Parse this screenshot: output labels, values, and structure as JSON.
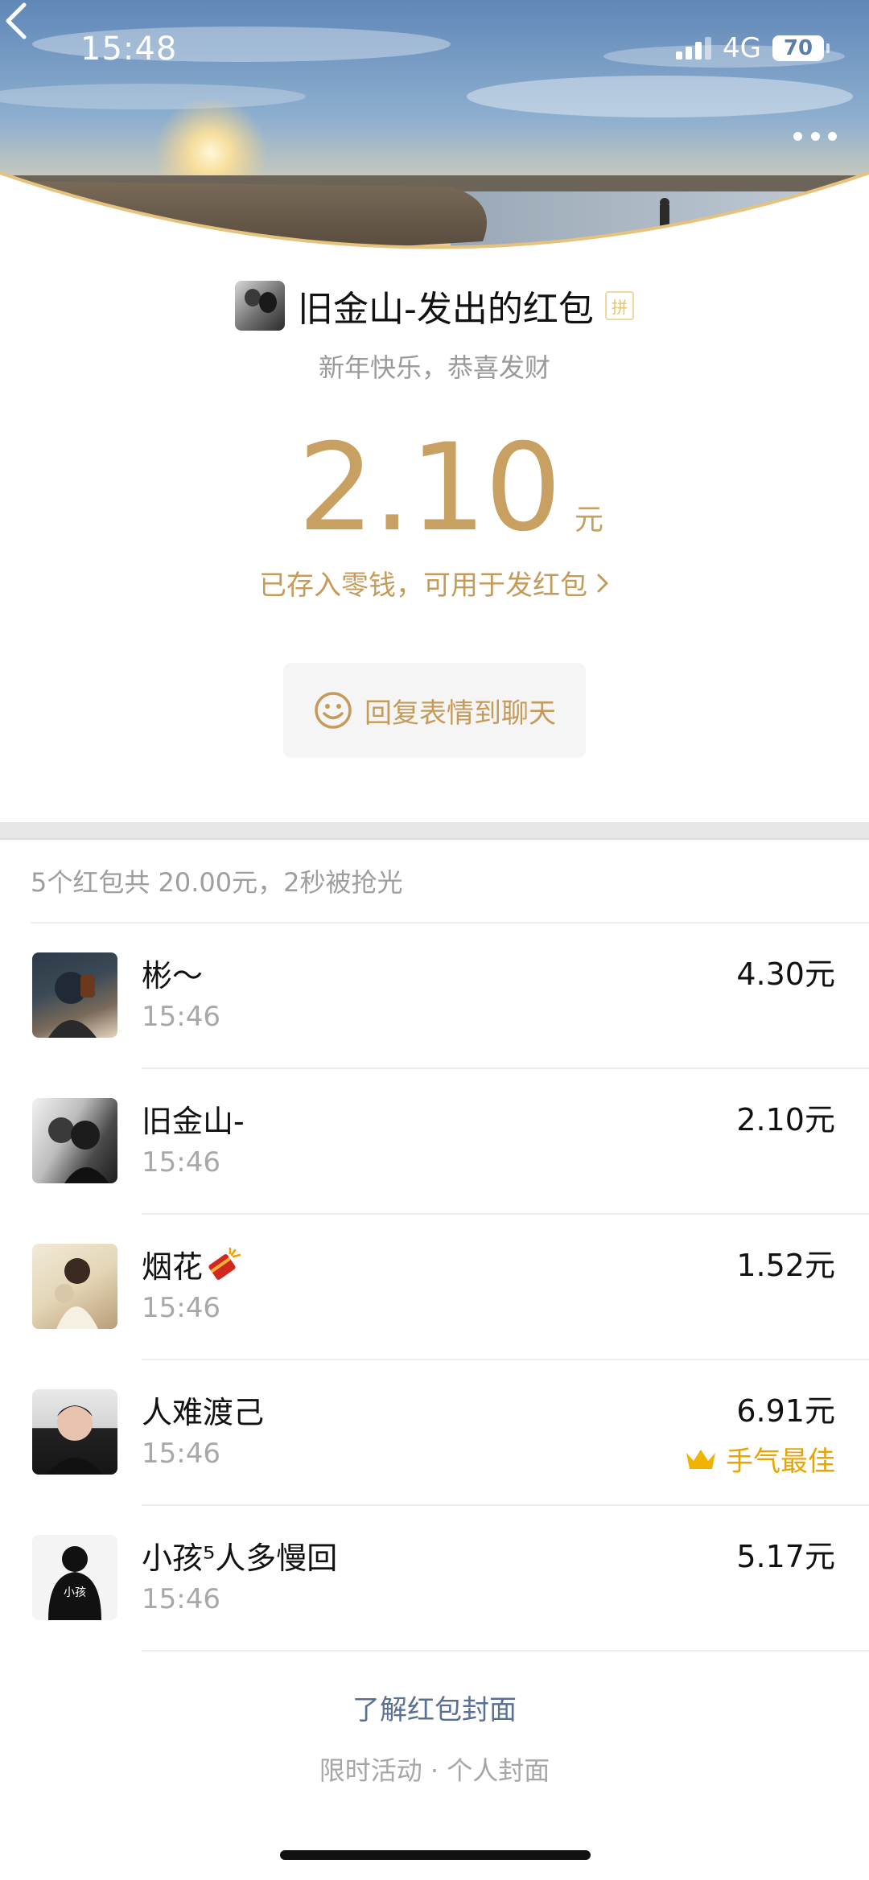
{
  "status_bar": {
    "time": "15:48",
    "network": "4G",
    "battery": "70"
  },
  "header": {
    "sender_title": "旧金山-发出的红包",
    "pin_badge": "拼",
    "greeting": "新年快乐，恭喜发财",
    "amount": "2.10",
    "amount_unit": "元",
    "deposit_link": "已存入零钱，可用于发红包",
    "reply_button": "回复表情到聊天"
  },
  "summary": "5个红包共 20.00元，2秒被抢光",
  "claims": [
    {
      "name": "彬～",
      "time": "15:46",
      "amount": "4.30元"
    },
    {
      "name": "旧金山-",
      "time": "15:46",
      "amount": "2.10元"
    },
    {
      "name": "烟花",
      "time": "15:46",
      "amount": "1.52元"
    },
    {
      "name": "人难渡己",
      "time": "15:46",
      "amount": "6.91元",
      "badge": "手气最佳"
    },
    {
      "name": "小孩⁵人多慢回",
      "time": "15:46",
      "amount": "5.17元"
    }
  ],
  "avatar_text": {
    "claim_4": "小孩"
  },
  "footer": {
    "cover_link": "了解红包封面",
    "cover_sub": "限时活动 · 个人封面"
  },
  "colors": {
    "gold": "#c7a062",
    "best_luck": "#e9a400",
    "link_blue": "#5a6f96"
  },
  "icons": [
    "back-icon",
    "more-icon",
    "signal-icon",
    "battery-icon",
    "smile-icon",
    "crown-icon",
    "firecracker-icon",
    "chevron-right-icon"
  ]
}
